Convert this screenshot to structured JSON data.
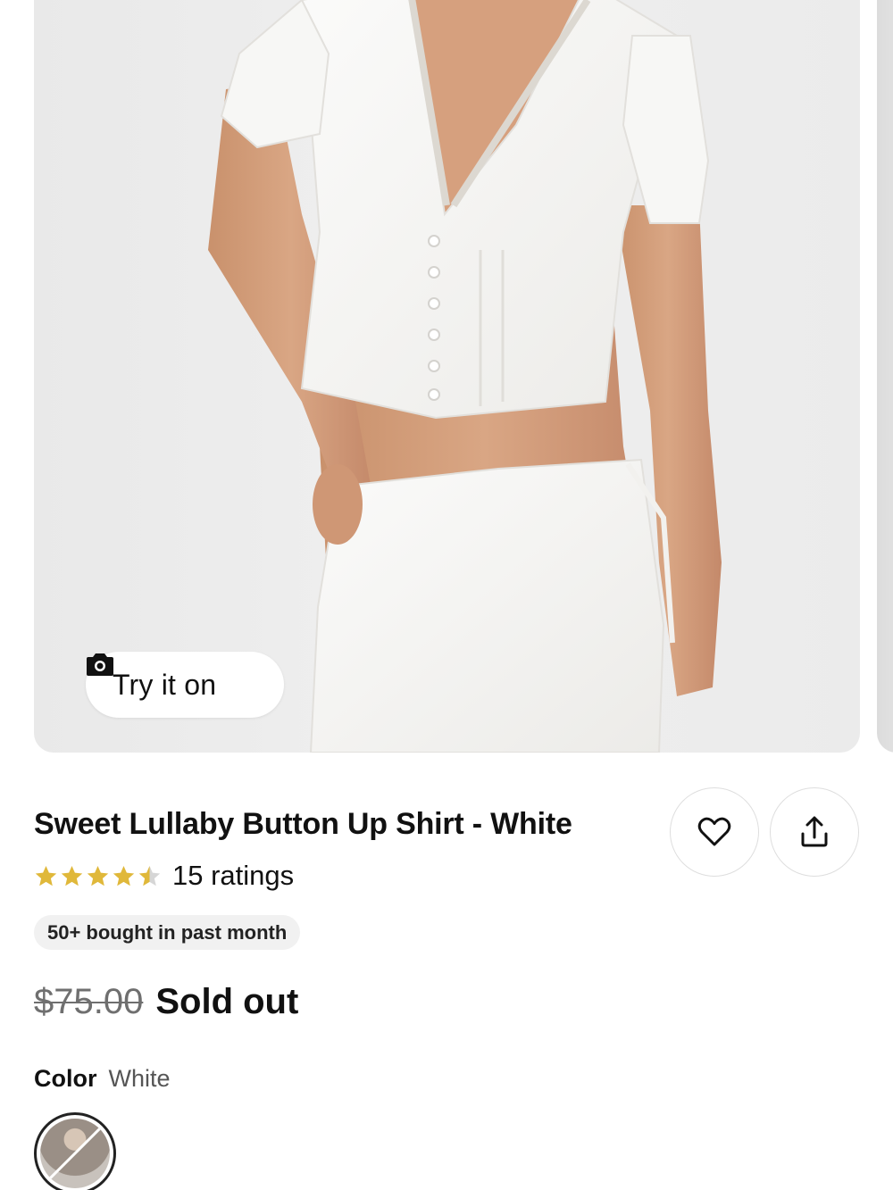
{
  "gallery": {
    "image_alt": "Model wearing white button up shirt and matching white skirt",
    "try_on_label": "Try it on",
    "try_on_icon": "camera-icon"
  },
  "product": {
    "title": "Sweet Lullaby Button Up Shirt - White",
    "rating": {
      "stars": 4.5,
      "max_stars": 5,
      "count_label": "15 ratings",
      "star_color": "#e0b83a"
    },
    "badge": "50+ bought in past month",
    "price": {
      "original": "$75.00",
      "status": "Sold out"
    },
    "color": {
      "label": "Color",
      "selected": "White"
    }
  },
  "actions": {
    "favorite_icon": "heart-icon",
    "share_icon": "share-icon"
  }
}
